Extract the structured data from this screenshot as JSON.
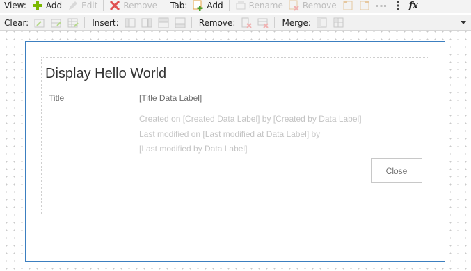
{
  "toolbar_top": {
    "view_label": "View:",
    "add_label": "Add",
    "edit_label": "Edit",
    "remove_label": "Remove",
    "tab_label": "Tab:",
    "tab_add_label": "Add",
    "tab_rename_label": "Rename",
    "tab_remove_label": "Remove",
    "fx_label": "fx"
  },
  "toolbar_bottom": {
    "clear_label": "Clear:",
    "insert_label": "Insert:",
    "remove_label": "Remove:",
    "merge_label": "Merge:"
  },
  "form": {
    "title": "Display Hello World",
    "field_label": "Title",
    "field_value": "[Title Data Label]",
    "meta_line1": "Created on [Created Data Label] by [Created by Data Label]",
    "meta_line2": "Last modified on [Last modified at Data Label] by",
    "meta_line3": "[Last modified by Data Label]",
    "close_label": "Close"
  },
  "colors": {
    "frame_border": "#3c7fc0",
    "add_icon_green": "#7ab800",
    "remove_icon_red": "#e05252"
  }
}
